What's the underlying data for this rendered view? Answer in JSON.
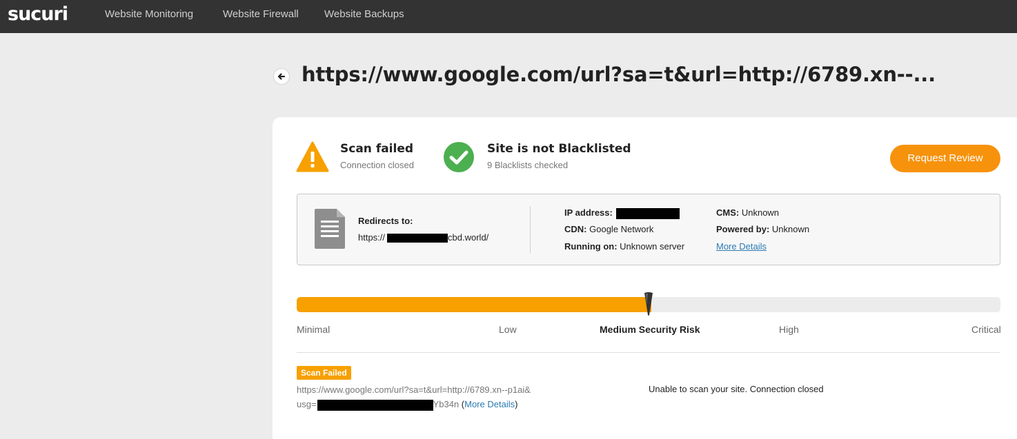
{
  "header": {
    "logo": "sucuri",
    "nav": [
      "Website Monitoring",
      "Website Firewall",
      "Website Backups"
    ]
  },
  "page": {
    "title": "https://www.google.com/url?sa=t&url=http://6789.xn--...",
    "back_icon": "arrow-left-icon"
  },
  "status": {
    "scan": {
      "title": "Scan failed",
      "subtitle": "Connection closed",
      "icon": "warning-triangle-icon"
    },
    "blacklist": {
      "title": "Site is not Blacklisted",
      "subtitle": "9 Blacklists checked",
      "icon": "check-circle-icon"
    },
    "request_review": "Request Review"
  },
  "info": {
    "redirects_label": "Redirects to:",
    "redirects_prefix": "https://",
    "redirects_suffix": "cbd.world/",
    "ip_label": "IP address:",
    "cdn_label": "CDN:",
    "cdn_value": "Google Network",
    "running_label": "Running on:",
    "running_value": "Unknown server",
    "cms_label": "CMS:",
    "cms_value": "Unknown",
    "powered_label": "Powered by:",
    "powered_value": "Unknown",
    "more_details": "More Details",
    "doc_icon": "document-icon"
  },
  "risk": {
    "labels": [
      "Minimal",
      "Low",
      "Medium Security Risk",
      "High",
      "Critical"
    ],
    "active_index": 2,
    "level_fraction": 0.5,
    "fill_color": "#f7a000"
  },
  "scan_result": {
    "badge": "Scan Failed",
    "url_line1": "https://www.google.com/url?sa=t&url=http://6789.xn--p1ai&",
    "url_line2_prefix": "usg=",
    "url_line2_suffix": "Yb34n",
    "paren_open": "(",
    "more_details": "More Details",
    "paren_close": ")",
    "message": "Unable to scan your site. Connection closed"
  },
  "colors": {
    "accent": "#f7920c",
    "warning": "#f7a000",
    "success": "#4caf50",
    "link": "#2a7ab0"
  }
}
